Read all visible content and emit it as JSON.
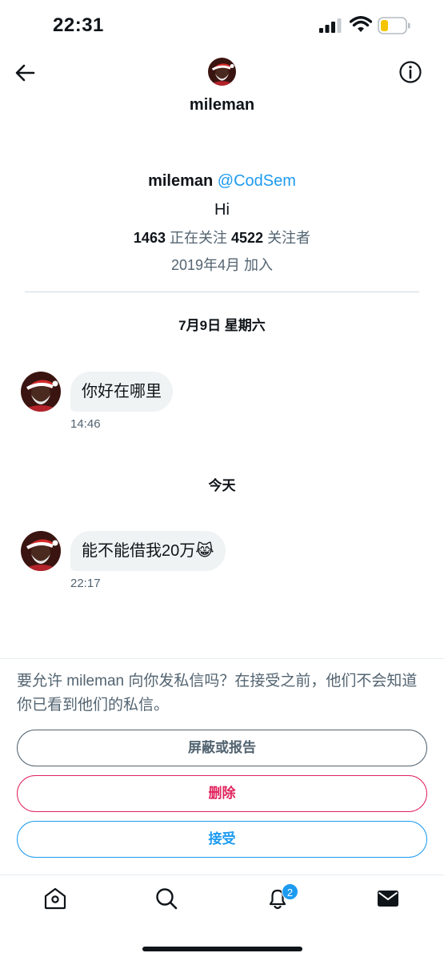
{
  "status_bar": {
    "time": "22:31",
    "icons": [
      "cellular-signal-icon",
      "wifi-icon",
      "battery-icon"
    ],
    "battery_color": "#f5c400"
  },
  "header": {
    "title": "mileman",
    "back_icon": "arrow-left-icon",
    "info_icon": "info-circle-icon"
  },
  "profile": {
    "display_name": "mileman",
    "handle": "@CodSem",
    "bio": "Hi",
    "following_count": "1463",
    "following_label": "正在关注",
    "followers_count": "4522",
    "followers_label": "关注者",
    "joined": "2019年4月 加入"
  },
  "conversation": {
    "groups": [
      {
        "date": "7月9日 星期六",
        "messages": [
          {
            "text": "你好在哪里",
            "time": "14:46"
          }
        ]
      },
      {
        "date": "今天",
        "messages": [
          {
            "text": "能不能借我20万",
            "emoji": "😹",
            "time": "22:17"
          }
        ]
      }
    ]
  },
  "request": {
    "prompt": "要允许 mileman 向你发私信吗？在接受之前，他们不会知道你已看到他们的私信。",
    "block_label": "屏蔽或报告",
    "delete_label": "删除",
    "accept_label": "接受"
  },
  "tab_bar": {
    "tabs": [
      "home-icon",
      "search-icon",
      "notifications-icon",
      "messages-icon"
    ],
    "notifications_badge": "2"
  },
  "colors": {
    "accent": "#1d9bf0",
    "danger": "#e0245e",
    "secondary_text": "#536471",
    "bubble_bg": "#eff3f4"
  }
}
